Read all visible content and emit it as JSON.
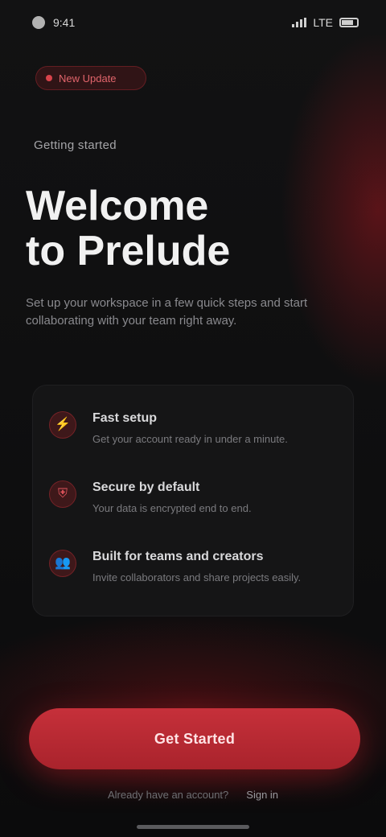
{
  "status_bar": {
    "time": "9:41",
    "carrier": "LTE"
  },
  "brand": {
    "chip_label": "New Update"
  },
  "hero": {
    "eyebrow": "Getting started",
    "headline_line1": "Welcome",
    "headline_line2": "to Prelude",
    "subtext": "Set up your workspace in a few quick steps and start collaborating with your team right away."
  },
  "features": [
    {
      "icon": "bolt-icon",
      "glyph": "⚡",
      "title": "Fast setup",
      "desc": "Get your account ready in under a minute."
    },
    {
      "icon": "shield-icon",
      "glyph": "⛨",
      "title": "Secure by default",
      "desc": "Your data is encrypted end to end."
    },
    {
      "icon": "users-icon",
      "glyph": "👥",
      "title": "Built for teams and creators",
      "desc": "Invite collaborators and share projects easily."
    }
  ],
  "cta": {
    "label": "Get Started"
  },
  "footer": {
    "prompt": "Already have an account?",
    "link": "Sign in"
  },
  "colors": {
    "accent": "#c6303a",
    "background": "#0e0e0f"
  }
}
